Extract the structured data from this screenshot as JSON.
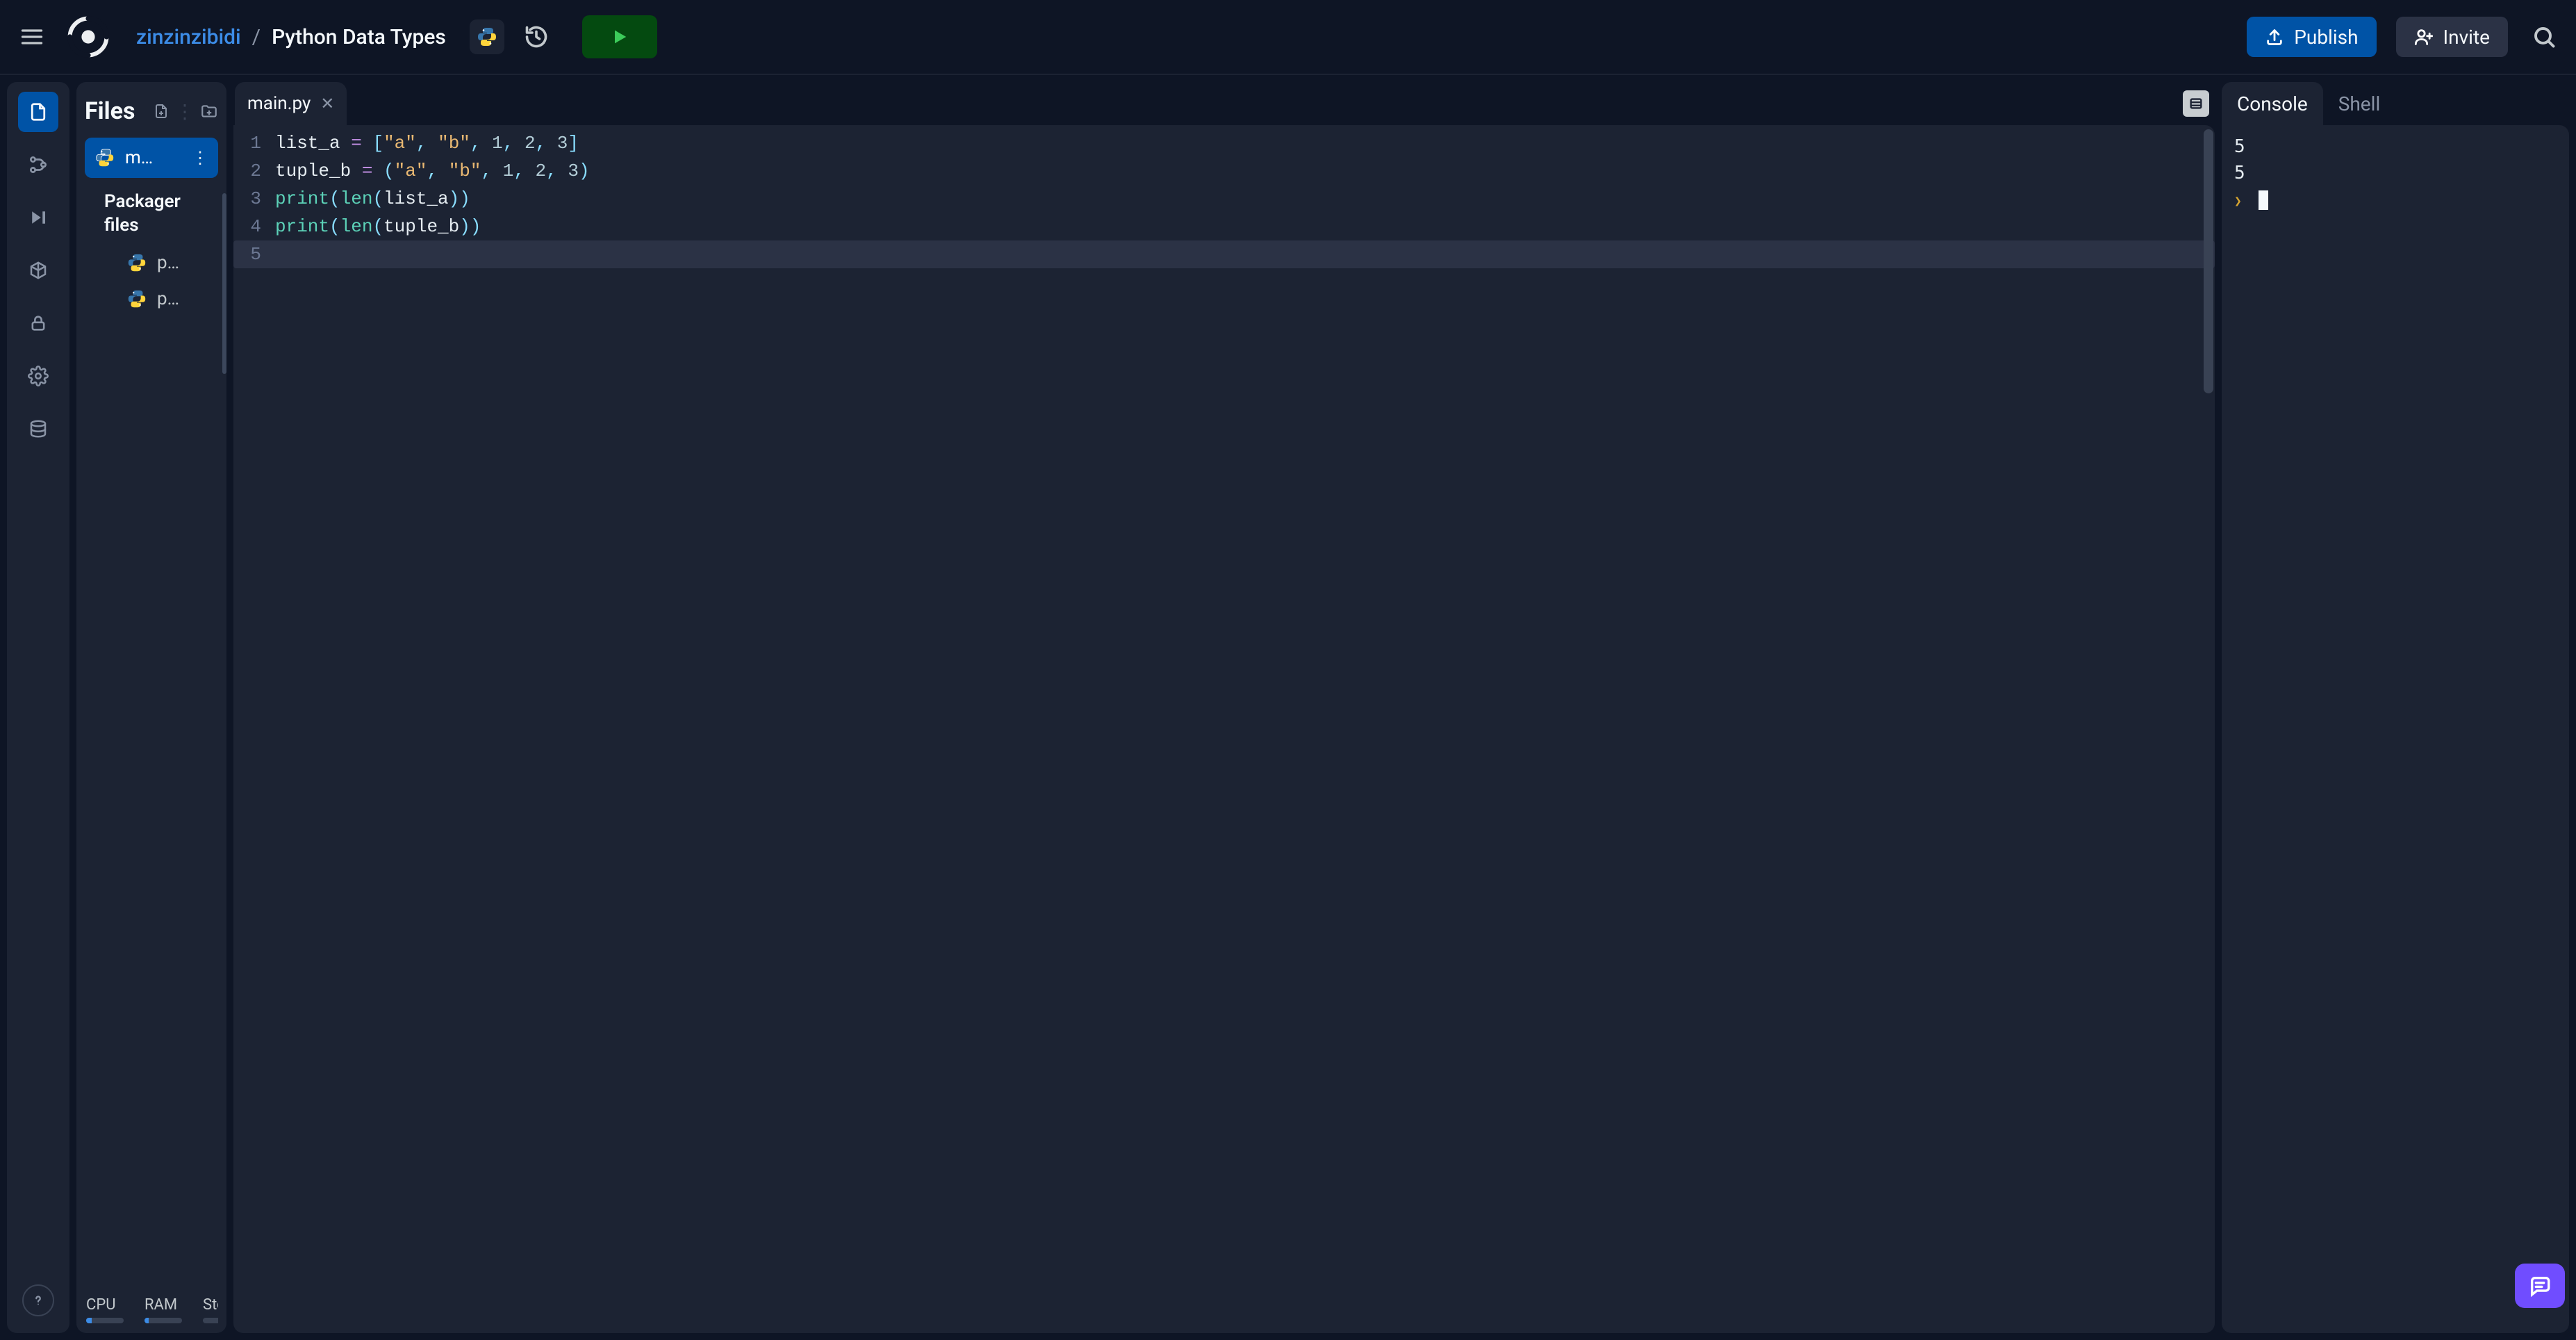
{
  "header": {
    "username": "zinzinzibidi",
    "separator": "/",
    "project_title": "Python Data Types",
    "publish_label": "Publish",
    "invite_label": "Invite"
  },
  "files_panel": {
    "title": "Files",
    "items": [
      {
        "label": "m…",
        "active": true
      }
    ],
    "section_title": "Packager files",
    "packages": [
      {
        "label": "p…"
      },
      {
        "label": "p…"
      }
    ],
    "meters": [
      {
        "label": "CPU",
        "fill": "14%"
      },
      {
        "label": "RAM",
        "fill": "12%"
      },
      {
        "label": "Sto",
        "fill": "0%"
      }
    ]
  },
  "editor": {
    "tab_label": "main.py",
    "lines": [
      {
        "num": "1",
        "tokens": [
          {
            "t": "id",
            "v": "list_a"
          },
          {
            "t": "sp",
            "v": " "
          },
          {
            "t": "op",
            "v": "="
          },
          {
            "t": "sp",
            "v": " "
          },
          {
            "t": "pun",
            "v": "["
          },
          {
            "t": "str",
            "v": "\"a\""
          },
          {
            "t": "pun",
            "v": ","
          },
          {
            "t": "sp",
            "v": " "
          },
          {
            "t": "str",
            "v": "\"b\""
          },
          {
            "t": "pun",
            "v": ","
          },
          {
            "t": "sp",
            "v": " "
          },
          {
            "t": "num",
            "v": "1"
          },
          {
            "t": "pun",
            "v": ","
          },
          {
            "t": "sp",
            "v": " "
          },
          {
            "t": "num",
            "v": "2"
          },
          {
            "t": "pun",
            "v": ","
          },
          {
            "t": "sp",
            "v": " "
          },
          {
            "t": "num",
            "v": "3"
          },
          {
            "t": "pun",
            "v": "]"
          }
        ]
      },
      {
        "num": "2",
        "tokens": [
          {
            "t": "id",
            "v": "tuple_b"
          },
          {
            "t": "sp",
            "v": " "
          },
          {
            "t": "op",
            "v": "="
          },
          {
            "t": "sp",
            "v": " "
          },
          {
            "t": "pun",
            "v": "("
          },
          {
            "t": "str",
            "v": "\"a\""
          },
          {
            "t": "pun",
            "v": ","
          },
          {
            "t": "sp",
            "v": " "
          },
          {
            "t": "str",
            "v": "\"b\""
          },
          {
            "t": "pun",
            "v": ","
          },
          {
            "t": "sp",
            "v": " "
          },
          {
            "t": "num",
            "v": "1"
          },
          {
            "t": "pun",
            "v": ","
          },
          {
            "t": "sp",
            "v": " "
          },
          {
            "t": "num",
            "v": "2"
          },
          {
            "t": "pun",
            "v": ","
          },
          {
            "t": "sp",
            "v": " "
          },
          {
            "t": "num",
            "v": "3"
          },
          {
            "t": "pun",
            "v": ")"
          }
        ]
      },
      {
        "num": "3",
        "tokens": [
          {
            "t": "fn",
            "v": "print"
          },
          {
            "t": "pun",
            "v": "("
          },
          {
            "t": "fn",
            "v": "len"
          },
          {
            "t": "pun",
            "v": "("
          },
          {
            "t": "id",
            "v": "list_a"
          },
          {
            "t": "pun",
            "v": ")"
          },
          {
            "t": "pun",
            "v": ")"
          }
        ]
      },
      {
        "num": "4",
        "tokens": [
          {
            "t": "fn",
            "v": "print"
          },
          {
            "t": "pun",
            "v": "("
          },
          {
            "t": "fn",
            "v": "len"
          },
          {
            "t": "pun",
            "v": "("
          },
          {
            "t": "id",
            "v": "tuple_b"
          },
          {
            "t": "pun",
            "v": ")"
          },
          {
            "t": "pun",
            "v": ")"
          }
        ]
      },
      {
        "num": "5",
        "tokens": [],
        "current": true
      }
    ]
  },
  "right": {
    "tabs": [
      {
        "label": "Console",
        "active": true
      },
      {
        "label": "Shell",
        "active": false
      }
    ],
    "output": [
      "5",
      "5"
    ]
  }
}
